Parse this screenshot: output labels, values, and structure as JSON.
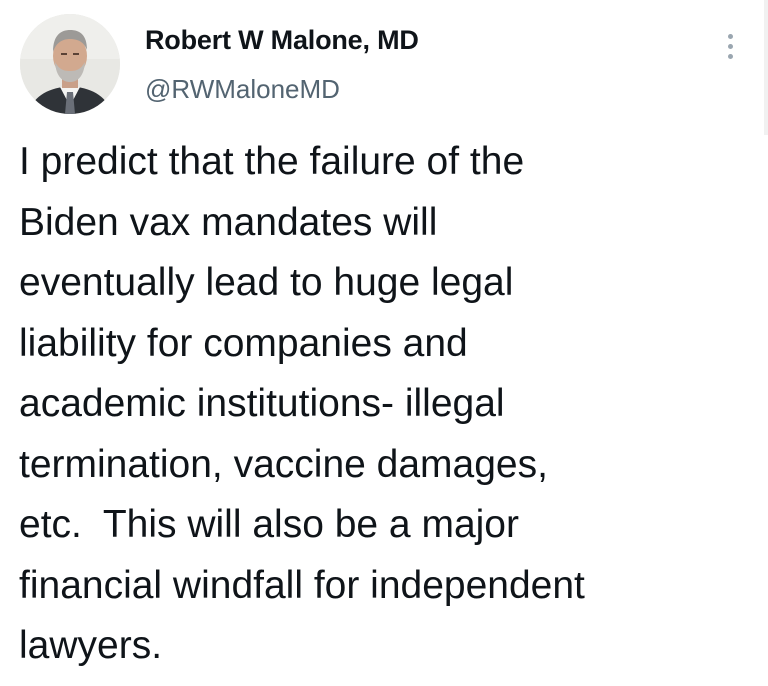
{
  "tweet": {
    "author": {
      "display_name": "Robert W Malone, MD",
      "handle": "@RWMaloneMD"
    },
    "text_lines": [
      "I predict that the failure of the",
      "Biden vax mandates will",
      "eventually lead to huge legal",
      "liability for companies and",
      "academic institutions- illegal",
      "termination, vaccine damages,",
      "etc.  This will also be a major",
      "financial windfall for independent",
      "lawyers."
    ],
    "more_icon": "more-vertical-icon"
  },
  "colors": {
    "text": "#0f1419",
    "handle": "#536471",
    "background": "#ffffff",
    "more_dots": "#9aa6b0"
  }
}
